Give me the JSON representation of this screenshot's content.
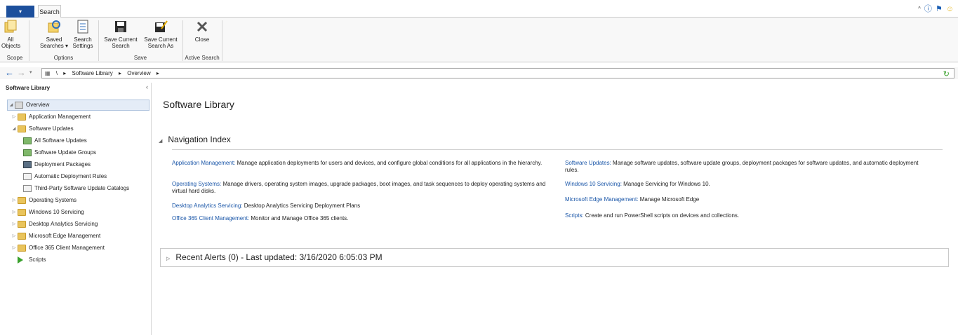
{
  "ribbon": {
    "tab": "Search",
    "buttons": {
      "all_objects": "All\nObjects",
      "saved_searches": "Saved\nSearches ▾",
      "search_settings": "Search\nSettings",
      "save_current_search": "Save Current\nSearch",
      "save_current_search_as": "Save Current\nSearch As",
      "close": "Close"
    },
    "groups": {
      "scope": "Scope",
      "options": "Options",
      "save": "Save",
      "active_search": "Active Search"
    }
  },
  "address": {
    "root": "\\",
    "crumbs": [
      "Software Library",
      "Overview"
    ]
  },
  "nav": {
    "title": "Software Library",
    "items": [
      {
        "label": "Overview"
      },
      {
        "label": "Application Management"
      },
      {
        "label": "Software Updates"
      },
      {
        "label": "All Software Updates"
      },
      {
        "label": "Software Update Groups"
      },
      {
        "label": "Deployment Packages"
      },
      {
        "label": "Automatic Deployment Rules"
      },
      {
        "label": "Third-Party Software Update Catalogs"
      },
      {
        "label": "Operating Systems"
      },
      {
        "label": "Windows 10 Servicing"
      },
      {
        "label": "Desktop Analytics Servicing"
      },
      {
        "label": "Microsoft Edge Management"
      },
      {
        "label": "Office 365 Client Management"
      },
      {
        "label": "Scripts"
      }
    ]
  },
  "main": {
    "title": "Software Library",
    "nav_index_heading": "Navigation Index",
    "entries_left": [
      {
        "link": "Application Management:",
        "desc": " Manage application deployments for users and devices, and configure global conditions for all applications in the hierarchy."
      },
      {
        "link": "Operating Systems:",
        "desc": " Manage drivers, operating system images, upgrade packages, boot images, and task sequences to deploy operating systems and virtual hard disks."
      },
      {
        "link": "Desktop Analytics Servicing:",
        "desc": " Desktop Analytics Servicing Deployment Plans"
      },
      {
        "link": "Office 365 Client Management:",
        "desc": " Monitor and Manage Office 365 clients."
      }
    ],
    "entries_right": [
      {
        "link": "Software Updates:",
        "desc": " Manage software updates, software update groups, deployment packages for software updates, and automatic deployment rules."
      },
      {
        "link": "Windows 10 Servicing:",
        "desc": " Manage Servicing for Windows 10."
      },
      {
        "link": "Microsoft Edge Management:",
        "desc": " Manage Microsoft Edge"
      },
      {
        "link": "Scripts:",
        "desc": " Create and run PowerShell scripts on devices and collections."
      }
    ],
    "alerts": "Recent Alerts (0) - Last updated: 3/16/2020 6:05:03 PM"
  }
}
